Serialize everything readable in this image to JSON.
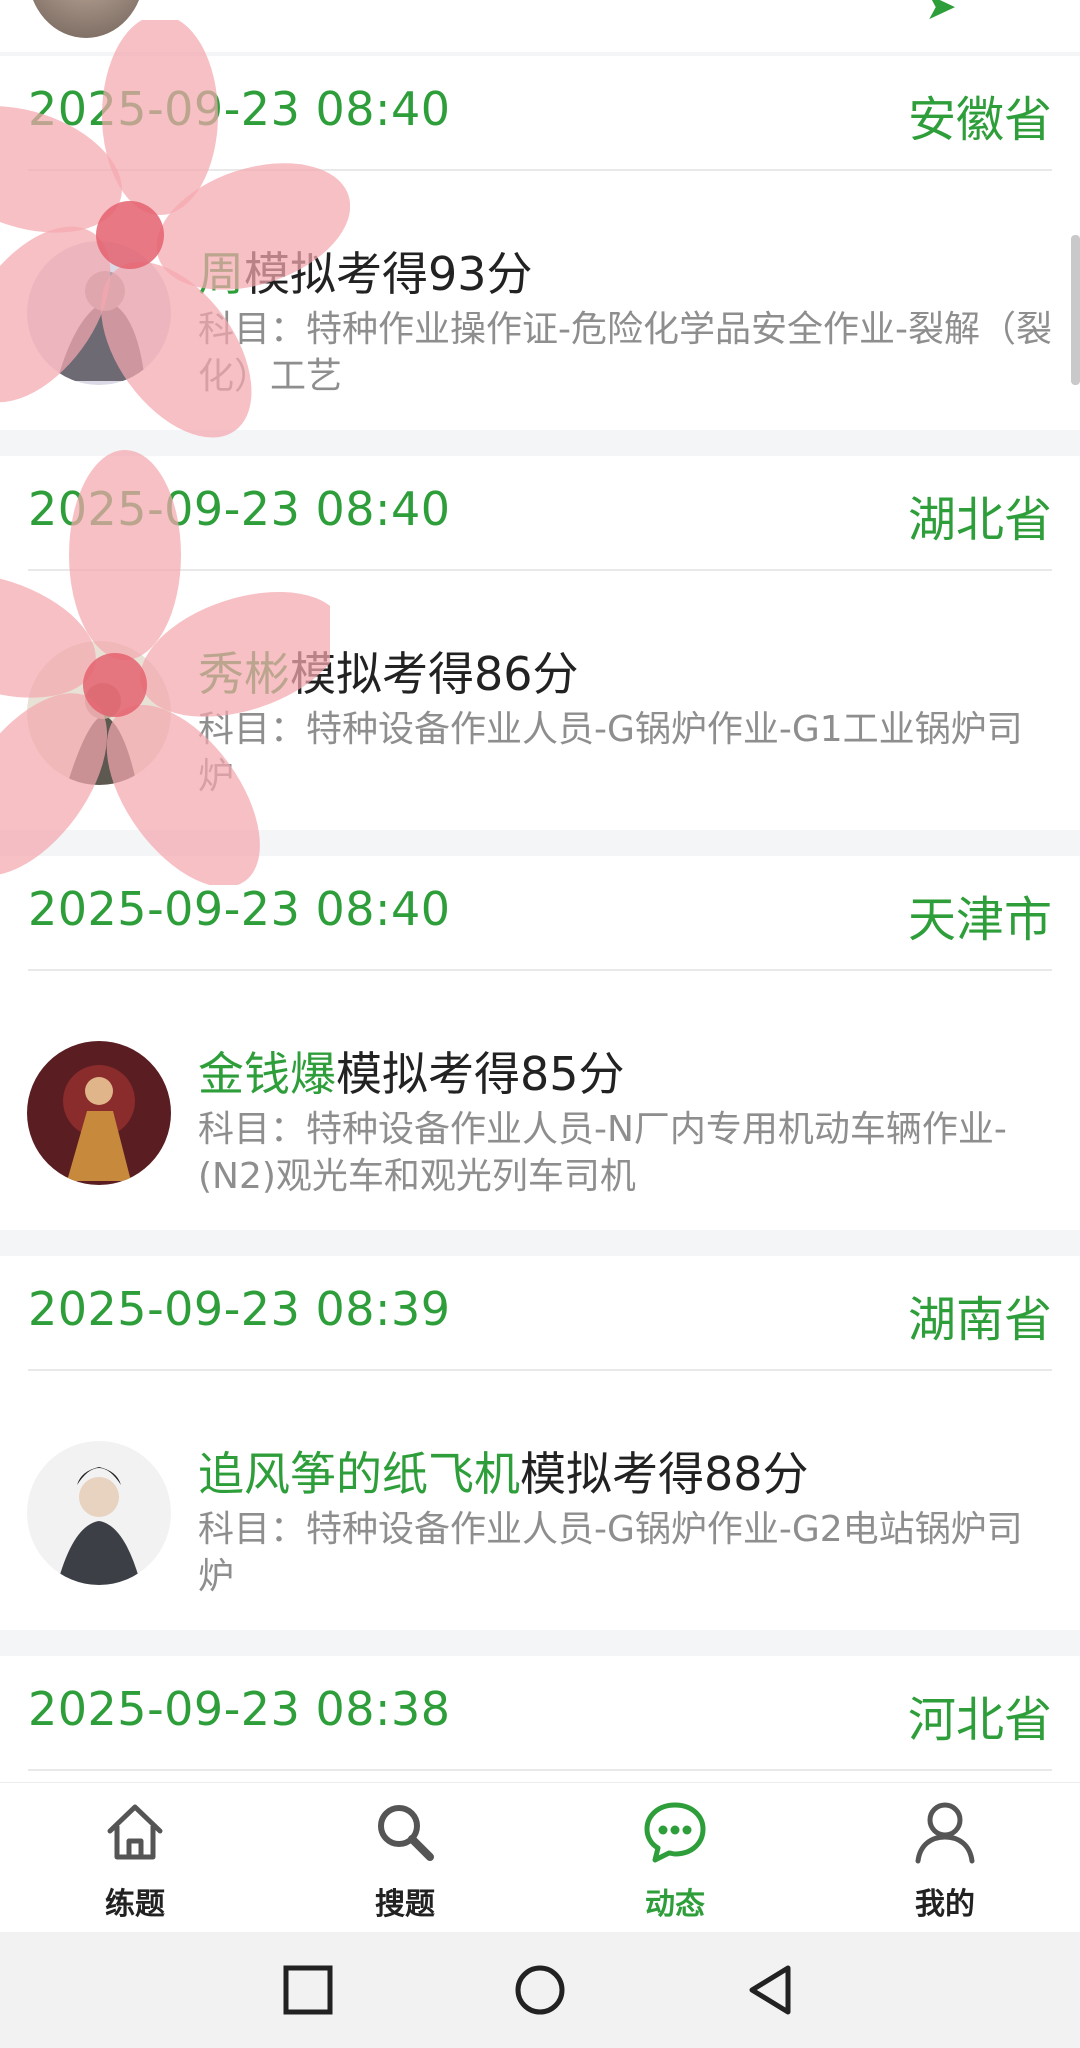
{
  "colors": {
    "accent": "#2e9e3a",
    "text": "#222222",
    "muted": "#8e8e8e"
  },
  "feed": [
    {
      "time": "2025-09-23 08:40",
      "province": "安徽省",
      "user": "周",
      "action": "模拟考得93分",
      "subject": "科目：特种作业操作证-危险化学品安全作业-裂解（裂化）工艺"
    },
    {
      "time": "2025-09-23 08:40",
      "province": "湖北省",
      "user": "秀彬",
      "action": "模拟考得86分",
      "subject": "科目：特种设备作业人员-G锅炉作业-G1工业锅炉司炉"
    },
    {
      "time": "2025-09-23 08:40",
      "province": "天津市",
      "user": "金钱爆",
      "action": "模拟考得85分",
      "subject": "科目：特种设备作业人员-N厂内专用机动车辆作业-(N2)观光车和观光列车司机"
    },
    {
      "time": "2025-09-23 08:39",
      "province": "湖南省",
      "user": "追风筝的纸飞机",
      "action": "模拟考得88分",
      "subject": "科目：特种设备作业人员-G锅炉作业-G2电站锅炉司炉"
    },
    {
      "time": "2025-09-23 08:38",
      "province": "河北省"
    }
  ],
  "tabbar": [
    {
      "label": "练题",
      "icon": "home-icon",
      "active": false
    },
    {
      "label": "搜题",
      "icon": "search-icon",
      "active": false
    },
    {
      "label": "动态",
      "icon": "chat-bubble-icon",
      "active": true
    },
    {
      "label": "我的",
      "icon": "user-icon",
      "active": false
    }
  ],
  "system_nav": [
    "recent-apps-icon",
    "home-circle-icon",
    "back-icon"
  ]
}
